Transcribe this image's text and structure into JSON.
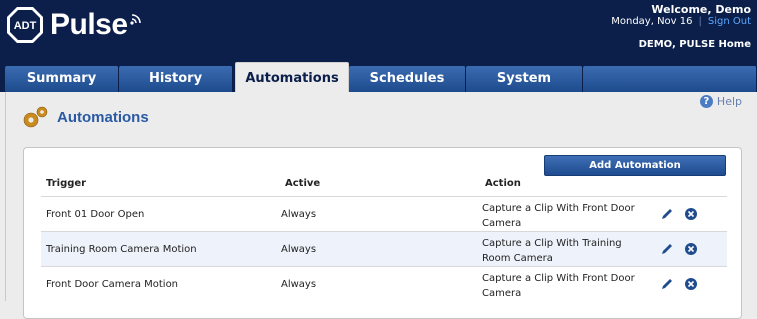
{
  "brand": {
    "badge": "ADT",
    "name": "Pulse"
  },
  "user": {
    "welcome": "Welcome, Demo",
    "date": "Monday, Nov 16",
    "signout": "Sign Out",
    "home": "DEMO, PULSE Home"
  },
  "tabs": [
    {
      "label": "Summary"
    },
    {
      "label": "History"
    },
    {
      "label": "Automations"
    },
    {
      "label": "Schedules"
    },
    {
      "label": "System"
    }
  ],
  "page": {
    "title": "Automations",
    "help": "Help"
  },
  "toolbar": {
    "add_label": "Add Automation"
  },
  "table": {
    "headers": [
      "Trigger",
      "Active",
      "Action"
    ],
    "rows": [
      {
        "trigger": "Front 01 Door Open",
        "active": "Always",
        "action": "Capture a Clip With Front Door Camera"
      },
      {
        "trigger": "Training Room Camera Motion",
        "active": "Always",
        "action": "Capture a Clip With Training Room Camera"
      },
      {
        "trigger": "Front Door Camera Motion",
        "active": "Always",
        "action": "Capture a Clip With Front Door Camera"
      }
    ]
  },
  "colors": {
    "header_bg": "#0b1f4a",
    "tab_blue": "#2a5aa3",
    "accent": "#2a5aa3",
    "link": "#5aa8ff"
  }
}
